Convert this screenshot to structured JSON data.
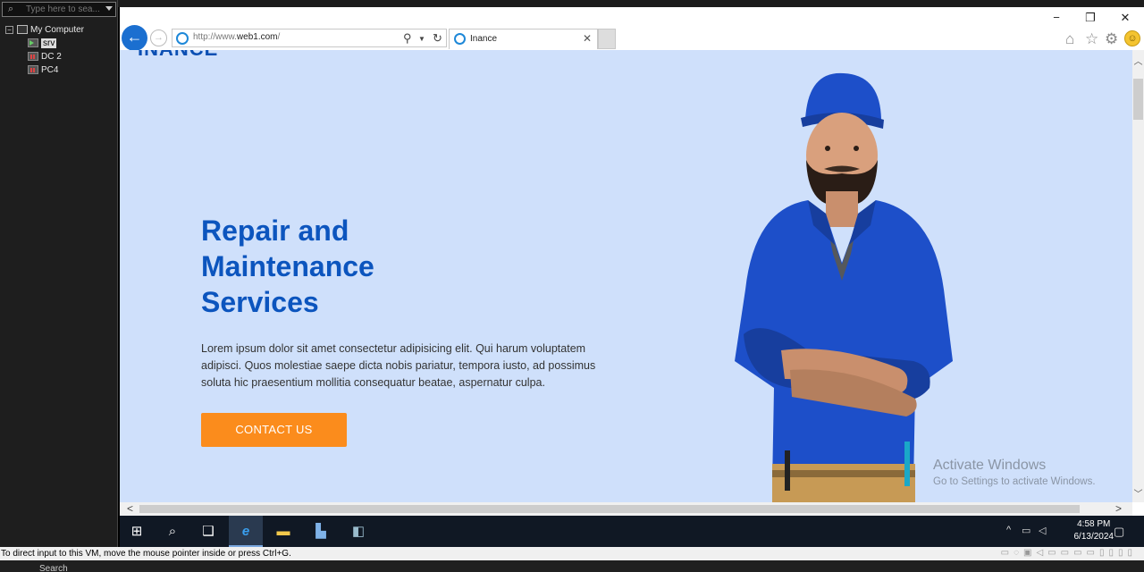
{
  "vm_panel": {
    "search_placeholder": "Type here to sea...",
    "root_label": "My Computer",
    "machines": [
      {
        "label": "srv",
        "state": "running",
        "selected": true
      },
      {
        "label": "DC 2",
        "state": "off",
        "selected": false
      },
      {
        "label": "PC4",
        "state": "off",
        "selected": false
      }
    ]
  },
  "browser": {
    "window_controls": [
      "minimize",
      "maximize",
      "close"
    ],
    "url_prefix": "http://www.",
    "url_domain": "web1.com",
    "url_suffix": "/",
    "tab_title": "Inance",
    "toolbar_icons": [
      "home-icon",
      "favorites-star-icon",
      "settings-gear-icon",
      "feedback-smiley-icon"
    ]
  },
  "page": {
    "brand_partial": "INANCE",
    "hero_title_lines": [
      "Repair and",
      "Maintenance",
      "Services"
    ],
    "hero_text": "Lorem ipsum dolor sit amet consectetur adipisicing elit. Qui harum voluptatem adipisci. Quos molestiae saepe dicta nobis pariatur, tempora iusto, ad possimus soluta hic praesentium mollitia consequatur beatae, aspernatur culpa.",
    "cta_label": "CONTACT US",
    "watermark_line1": "Activate Windows",
    "watermark_line2": "Go to Settings to activate Windows."
  },
  "guest_taskbar": {
    "time": "4:58 PM",
    "date": "6/13/2024"
  },
  "host": {
    "status_message": "To direct input to this VM, move the mouse pointer inside or press Ctrl+G.",
    "search_label": "Search"
  },
  "colors": {
    "page_bg": "#cfe0fb",
    "title_blue": "#0c55be",
    "cta_orange": "#fb8c1c",
    "worker_uniform": "#1d4fc9"
  }
}
